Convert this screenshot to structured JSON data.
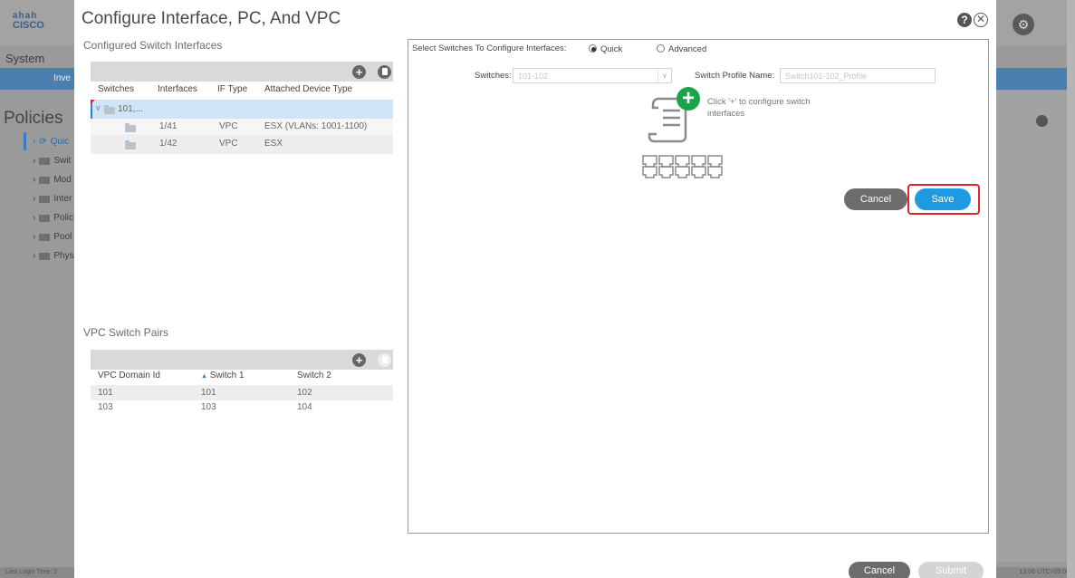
{
  "background": {
    "logo_bars": "ahah",
    "logo_text": "CISCO",
    "system_label": "System",
    "inventory_tab": "Inve",
    "policies_title": "Policies",
    "nav_items": [
      "Quic",
      "Swit",
      "Mod",
      "Inter",
      "Polic",
      "Pool",
      "Phys"
    ],
    "bottom_left": "Last Login Time: 2",
    "bottom_right": "13:06 UTC+00:00"
  },
  "modal": {
    "title": "Configure Interface, PC, And VPC",
    "help_glyph": "?",
    "close_glyph": "✕",
    "configured_label": "Configured Switch Interfaces",
    "iface_table": {
      "columns": [
        "Switches",
        "Interfaces",
        "IF Type",
        "Attached Device Type"
      ],
      "group_row": "101,...",
      "rows": [
        {
          "interface": "1/41",
          "if_type": "VPC",
          "device": "ESX (VLANs: 1001-1100)"
        },
        {
          "interface": "1/42",
          "if_type": "VPC",
          "device": "ESX"
        }
      ]
    },
    "vpc_label": "VPC Switch Pairs",
    "vpc_table": {
      "columns": [
        "VPC Domain Id",
        "Switch 1",
        "Switch 2"
      ],
      "sort_glyph": "▲",
      "rows": [
        {
          "domain": "101",
          "sw1": "101",
          "sw2": "102"
        },
        {
          "domain": "103",
          "sw1": "103",
          "sw2": "104"
        }
      ]
    },
    "right": {
      "select_label": "Select Switches To Configure Interfaces:",
      "quick_label": "Quick",
      "advanced_label": "Advanced",
      "switches_label": "Switches:",
      "switches_value": "101-102",
      "profile_label": "Switch Profile Name:",
      "profile_value": "Switch101-102_Profile",
      "hint_line1": "Click '+' to configure switch",
      "hint_line2": "interfaces",
      "cancel_label": "Cancel",
      "save_label": "Save"
    },
    "footer": {
      "cancel_label": "Cancel",
      "submit_label": "Submit"
    }
  },
  "colors": {
    "save_blue": "#1f9ae0",
    "highlight_red": "#e2222a",
    "plus_green": "#1aa34a"
  }
}
